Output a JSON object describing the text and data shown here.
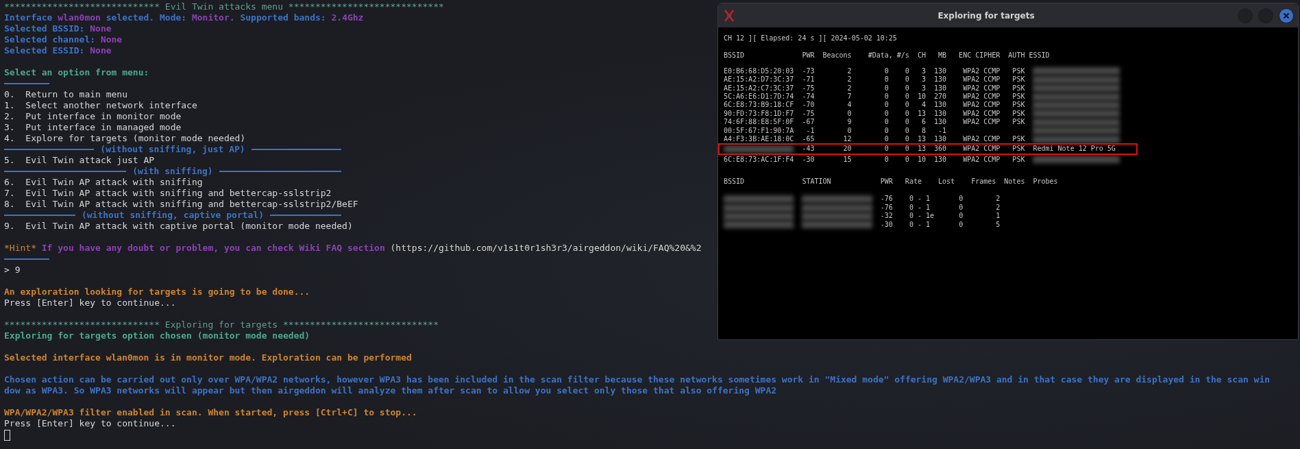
{
  "terminal": {
    "lines": [
      {
        "kind": "text",
        "segments": [
          {
            "kind": "header",
            "text": "***************************** Evil Twin attacks menu *****************************"
          }
        ]
      },
      {
        "kind": "text",
        "segments": [
          {
            "kind": "info",
            "text": "Interface "
          },
          {
            "kind": "value",
            "text": "wlan0mon"
          },
          {
            "kind": "info",
            "text": " selected. Mode: "
          },
          {
            "kind": "value",
            "text": "Monitor"
          },
          {
            "kind": "info",
            "text": ". Supported bands: "
          },
          {
            "kind": "value",
            "text": "2.4Ghz"
          }
        ]
      },
      {
        "kind": "text",
        "segments": [
          {
            "kind": "info",
            "text": "Selected BSSID: "
          },
          {
            "kind": "value",
            "text": "None"
          }
        ]
      },
      {
        "kind": "text",
        "segments": [
          {
            "kind": "info",
            "text": "Selected channel: "
          },
          {
            "kind": "value",
            "text": "None"
          }
        ]
      },
      {
        "kind": "text",
        "segments": [
          {
            "kind": "info",
            "text": "Selected ESSID: "
          },
          {
            "kind": "value",
            "text": "None"
          }
        ]
      },
      {
        "kind": "blank"
      },
      {
        "kind": "text",
        "segments": [
          {
            "kind": "prompt",
            "text": "Select an option from menu:"
          }
        ]
      },
      {
        "kind": "short-rule"
      },
      {
        "kind": "text",
        "segments": [
          {
            "kind": "plain",
            "text": "0.  Return to main menu"
          }
        ]
      },
      {
        "kind": "text",
        "segments": [
          {
            "kind": "plain",
            "text": "1.  Select another network interface"
          }
        ]
      },
      {
        "kind": "text",
        "segments": [
          {
            "kind": "plain",
            "text": "2.  Put interface in monitor mode"
          }
        ]
      },
      {
        "kind": "text",
        "segments": [
          {
            "kind": "plain",
            "text": "3.  Put interface in managed mode"
          }
        ]
      },
      {
        "kind": "text",
        "segments": [
          {
            "kind": "plain",
            "text": "4.  Explore for targets (monitor mode needed)"
          }
        ]
      },
      {
        "kind": "rule",
        "label": "(without sniffing, just AP)"
      },
      {
        "kind": "text",
        "segments": [
          {
            "kind": "plain",
            "text": "5.  Evil Twin attack just AP"
          }
        ]
      },
      {
        "kind": "rule",
        "label": "(with sniffing)"
      },
      {
        "kind": "text",
        "segments": [
          {
            "kind": "plain",
            "text": "6.  Evil Twin AP attack with sniffing"
          }
        ]
      },
      {
        "kind": "text",
        "segments": [
          {
            "kind": "plain",
            "text": "7.  Evil Twin AP attack with sniffing and bettercap-sslstrip2"
          }
        ]
      },
      {
        "kind": "text",
        "segments": [
          {
            "kind": "plain",
            "text": "8.  Evil Twin AP attack with sniffing and bettercap-sslstrip2/BeEF"
          }
        ]
      },
      {
        "kind": "rule",
        "label": "(without sniffing, captive portal)"
      },
      {
        "kind": "text",
        "segments": [
          {
            "kind": "plain",
            "text": "9.  Evil Twin AP attack with captive portal (monitor mode needed)"
          }
        ]
      },
      {
        "kind": "blank"
      },
      {
        "kind": "text",
        "segments": [
          {
            "kind": "hint-tag",
            "text": "*Hint*"
          },
          {
            "kind": "hint",
            "text": " If you have any doubt or problem, you can check Wiki FAQ section "
          },
          {
            "kind": "plain",
            "text": "(https://github.com/v1s1t0r1sh3r3/airgeddon/wiki/FAQ%20&%2"
          }
        ]
      },
      {
        "kind": "short-rule"
      },
      {
        "kind": "text",
        "segments": [
          {
            "kind": "plain",
            "text": "> 9"
          }
        ]
      },
      {
        "kind": "blank"
      },
      {
        "kind": "text",
        "segments": [
          {
            "kind": "warn",
            "text": "An exploration looking for targets is going to be done..."
          }
        ]
      },
      {
        "kind": "text",
        "segments": [
          {
            "kind": "plain",
            "text": "Press [Enter] key to continue..."
          }
        ]
      },
      {
        "kind": "blank"
      },
      {
        "kind": "text",
        "segments": [
          {
            "kind": "header",
            "text": "***************************** Exploring for targets *****************************"
          }
        ]
      },
      {
        "kind": "text",
        "segments": [
          {
            "kind": "prompt",
            "text": "Exploring for targets option chosen (monitor mode needed)"
          }
        ]
      },
      {
        "kind": "blank"
      },
      {
        "kind": "text",
        "segments": [
          {
            "kind": "warn",
            "text": "Selected interface wlan0mon is in monitor mode. Exploration can be performed"
          }
        ]
      },
      {
        "kind": "blank"
      },
      {
        "kind": "text",
        "segments": [
          {
            "kind": "info",
            "text": "Chosen action can be carried out only over WPA/WPA2 networks, however WPA3 has been included in the scan filter because these networks sometimes work in \"Mixed mode\" offering WPA2/WPA3 and in that case they are displayed in the scan win"
          }
        ]
      },
      {
        "kind": "text",
        "segments": [
          {
            "kind": "info",
            "text": "dow as WPA3. So WPA3 networks will appear but then airgeddon will analyze them after scan to allow you select only those that also offering WPA2"
          }
        ]
      },
      {
        "kind": "blank"
      },
      {
        "kind": "text",
        "segments": [
          {
            "kind": "warn",
            "text": "WPA/WPA2/WPA3 filter enabled in scan. When started, press [Ctrl+C] to stop..."
          }
        ]
      },
      {
        "kind": "text",
        "segments": [
          {
            "kind": "plain",
            "text": "Press [Enter] key to continue..."
          }
        ]
      },
      {
        "kind": "cursor"
      }
    ]
  },
  "scan_window": {
    "title": "Exploring for targets",
    "status": "CH 12 ][ Elapsed: 24 s ][ 2024-05-02 10:25",
    "ap_columns": [
      "BSSID",
      "PWR",
      "Beacons",
      "#Data, #/s",
      "CH",
      "MB",
      "ENC",
      "CIPHER",
      "AUTH",
      "ESSID"
    ],
    "ap_rows": [
      {
        "bssid": "E0:B6:68:D5:20:03",
        "pwr": "-73",
        "beacons": "2",
        "data": "0",
        "per_s": "0",
        "ch": "3",
        "mb": "130",
        "enc": "WPA2",
        "cipher": "CCMP",
        "auth": "PSK",
        "essid_blurred": true,
        "highlighted": false
      },
      {
        "bssid": "AE:15:A2:D7:3C:37",
        "pwr": "-71",
        "beacons": "2",
        "data": "0",
        "per_s": "0",
        "ch": "3",
        "mb": "130",
        "enc": "WPA2",
        "cipher": "CCMP",
        "auth": "PSK",
        "essid_blurred": true,
        "highlighted": false
      },
      {
        "bssid": "AE:15:A2:C7:3C:37",
        "pwr": "-75",
        "beacons": "2",
        "data": "0",
        "per_s": "0",
        "ch": "3",
        "mb": "130",
        "enc": "WPA2",
        "cipher": "CCMP",
        "auth": "PSK",
        "essid_blurred": true,
        "highlighted": false
      },
      {
        "bssid": "5C:A6:E6:D1:7D:74",
        "pwr": "-74",
        "beacons": "7",
        "data": "0",
        "per_s": "0",
        "ch": "10",
        "mb": "270",
        "enc": "WPA2",
        "cipher": "CCMP",
        "auth": "PSK",
        "essid_blurred": true,
        "highlighted": false
      },
      {
        "bssid": "6C:E8:73:B9:18:CF",
        "pwr": "-70",
        "beacons": "4",
        "data": "0",
        "per_s": "0",
        "ch": "4",
        "mb": "130",
        "enc": "WPA2",
        "cipher": "CCMP",
        "auth": "PSK",
        "essid_blurred": true,
        "highlighted": false
      },
      {
        "bssid": "90:FD:73:F8:1D:F7",
        "pwr": "-75",
        "beacons": "0",
        "data": "0",
        "per_s": "0",
        "ch": "13",
        "mb": "130",
        "enc": "WPA2",
        "cipher": "CCMP",
        "auth": "PSK",
        "essid_blurred": true,
        "highlighted": false
      },
      {
        "bssid": "74:6F:88:E8:5F:0F",
        "pwr": "-67",
        "beacons": "9",
        "data": "0",
        "per_s": "0",
        "ch": "6",
        "mb": "130",
        "enc": "WPA2",
        "cipher": "CCMP",
        "auth": "PSK",
        "essid_blurred": true,
        "highlighted": false
      },
      {
        "bssid": "00:5F:67:F1:90:7A",
        "pwr": "-1",
        "beacons": "0",
        "data": "0",
        "per_s": "0",
        "ch": "8",
        "mb": "-1",
        "essid_blurred": true,
        "highlighted": false
      },
      {
        "bssid": "A4:F3:3B:AE:18:0C",
        "pwr": "-65",
        "beacons": "12",
        "data": "0",
        "per_s": "0",
        "ch": "13",
        "mb": "130",
        "enc": "WPA2",
        "cipher": "CCMP",
        "auth": "PSK",
        "essid_blurred": true,
        "highlighted": false
      },
      {
        "bssid_blurred": true,
        "pwr": "-43",
        "beacons": "20",
        "data": "0",
        "per_s": "0",
        "ch": "13",
        "mb": "360",
        "enc": "WPA2",
        "cipher": "CCMP",
        "auth": "PSK",
        "essid": "Redmi Note 12 Pro 5G",
        "highlighted": true
      },
      {
        "bssid": "6C:E8:73:AC:1F:F4",
        "pwr": "-30",
        "beacons": "15",
        "data": "0",
        "per_s": "0",
        "ch": "10",
        "mb": "130",
        "enc": "WPA2",
        "cipher": "CCMP",
        "auth": "PSK",
        "essid_blurred": true,
        "highlighted": false
      }
    ],
    "station_columns": [
      "BSSID",
      "STATION",
      "PWR",
      "Rate",
      "Lost",
      "Frames",
      "Notes",
      "Probes"
    ],
    "station_rows": [
      {
        "bssid_blurred": true,
        "station_blurred": true,
        "pwr": "-76",
        "rate": "0 - 1",
        "lost": "0",
        "frames": "2"
      },
      {
        "bssid_blurred": true,
        "station_blurred": true,
        "pwr": "-76",
        "rate": "0 - 1",
        "lost": "0",
        "frames": "2"
      },
      {
        "bssid_blurred": true,
        "station_blurred": true,
        "pwr": "-32",
        "rate": "0 - 1e",
        "lost": "0",
        "frames": "1"
      },
      {
        "bssid_blurred": true,
        "station_blurred": true,
        "pwr": "-30",
        "rate": "0 - 1",
        "lost": "0",
        "frames": "5"
      }
    ]
  }
}
